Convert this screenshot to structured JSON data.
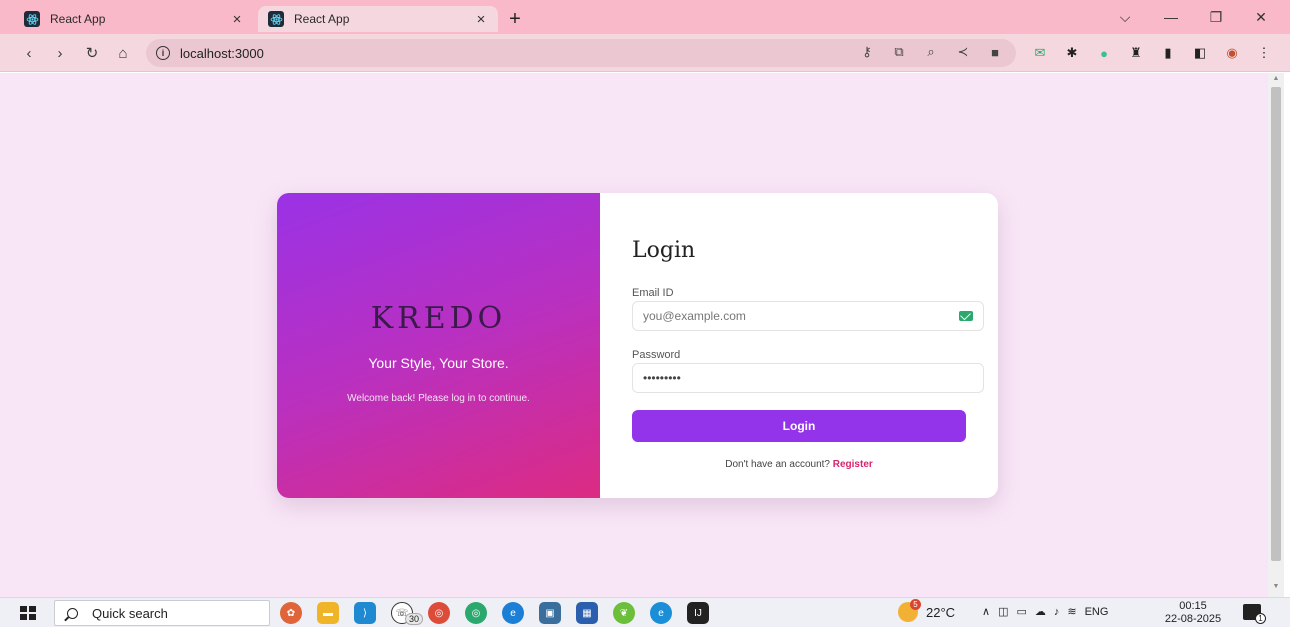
{
  "browser": {
    "tabs": [
      {
        "title": "React App",
        "close": "×"
      },
      {
        "title": "React App",
        "close": "×"
      }
    ],
    "new_tab": "+",
    "window": {
      "tab_search": "⌵",
      "minimize": "—",
      "restore": "❐",
      "close": "✕"
    },
    "toolbar": {
      "back": "‹",
      "forward": "›",
      "reload": "↻",
      "home": "⌂"
    },
    "url": "localhost:3000"
  },
  "page": {
    "brand": "KREDO",
    "tagline": "Your Style, Your Store.",
    "welcome": "Welcome back! Please log in to continue.",
    "login": {
      "title": "Login",
      "email_label": "Email ID",
      "email_placeholder": "you@example.com",
      "password_label": "Password",
      "password_value": "•••••••••",
      "button": "Login",
      "signup_prompt": "Don't have an account?",
      "signup_link": "Register"
    }
  },
  "colors": {
    "gradient_start": "#9a32e6",
    "gradient_end": "#dc2b82",
    "button": "#9333ea",
    "link": "#d6246e",
    "page_bg": "#f8e6f6",
    "tabstrip_bg": "#f9b9c8"
  },
  "taskbar": {
    "search_text": "Quick search",
    "whatsapp_badge": "30",
    "weather_badge": "5",
    "temperature": "22°C",
    "language": "ENG",
    "time": "00:15",
    "date": "22-08-2025",
    "notification_count": "1"
  }
}
